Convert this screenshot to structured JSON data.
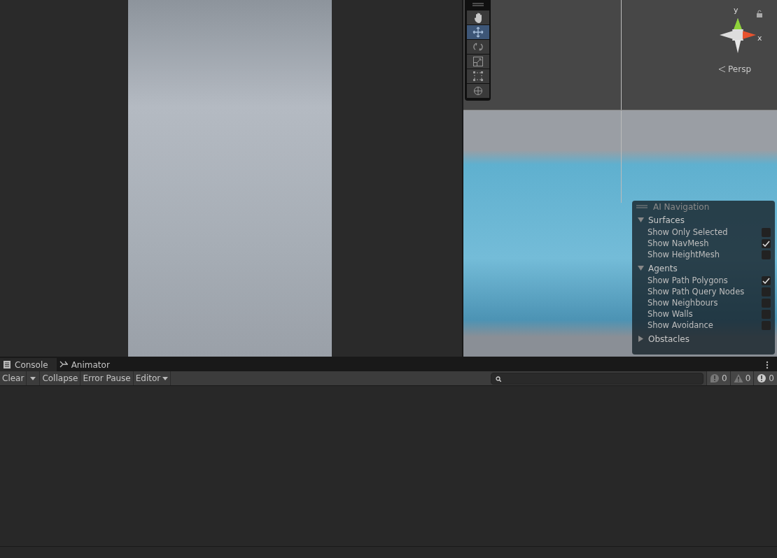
{
  "scene_view": {
    "tools": [
      {
        "kind": "hand",
        "selected": false
      },
      {
        "kind": "move",
        "selected": true
      },
      {
        "kind": "rotate",
        "selected": false
      },
      {
        "kind": "scale",
        "selected": false
      },
      {
        "kind": "rect",
        "selected": false
      },
      {
        "kind": "transform",
        "selected": false
      }
    ],
    "gizmo": {
      "y_label": "y",
      "x_label": "x"
    },
    "projection": "Persp"
  },
  "ai_navigation": {
    "title": "AI Navigation",
    "sections": [
      {
        "title": "Surfaces",
        "expanded": true,
        "options": [
          {
            "label": "Show Only Selected",
            "checked": false
          },
          {
            "label": "Show NavMesh",
            "checked": true
          },
          {
            "label": "Show HeightMesh",
            "checked": false
          }
        ]
      },
      {
        "title": "Agents",
        "expanded": true,
        "options": [
          {
            "label": "Show Path Polygons",
            "checked": true
          },
          {
            "label": "Show Path Query Nodes",
            "checked": false
          },
          {
            "label": "Show Neighbours",
            "checked": false
          },
          {
            "label": "Show Walls",
            "checked": false
          },
          {
            "label": "Show Avoidance",
            "checked": false
          }
        ]
      },
      {
        "title": "Obstacles",
        "expanded": false
      }
    ]
  },
  "tabs": [
    {
      "label": "Console",
      "kind": "console",
      "selected": true
    },
    {
      "label": "Animator",
      "kind": "animator",
      "selected": false
    }
  ],
  "console_toolbar": {
    "buttons": [
      {
        "label": "Clear",
        "kind": "split"
      },
      {
        "label": "Collapse",
        "kind": "plain"
      },
      {
        "label": "Error Pause",
        "kind": "plain"
      },
      {
        "label": "Editor",
        "kind": "dropdown"
      }
    ],
    "counts": [
      {
        "kind": "info",
        "count": "0"
      },
      {
        "kind": "warning",
        "count": "0"
      },
      {
        "kind": "error",
        "count": "0"
      }
    ]
  }
}
